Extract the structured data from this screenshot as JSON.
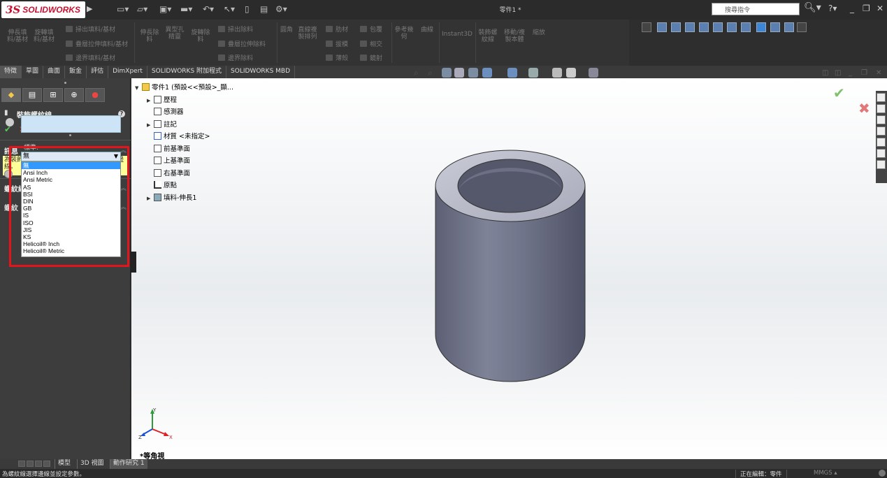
{
  "app": {
    "logo_ds": "3S",
    "logo_text": "SOLIDWORKS",
    "document_title": "零件1 *",
    "search_placeholder": "搜尋指令"
  },
  "commands": {
    "extrude_boss": "伸長填\n料/基材",
    "revolve_boss": "旋轉填\n料/基材",
    "swept_boss": "掃出填料/基材",
    "loft_boss": "疊層拉伸填料/基材",
    "boundary_boss": "邊界填料/基材",
    "extrude_cut": "伸長除\n料",
    "hole_wizard": "異型孔\n精靈",
    "revolve_cut": "旋轉除\n料",
    "swept_cut": "掃出除料",
    "loft_cut": "疊層拉伸除料",
    "boundary_cut": "邊界除料",
    "fillet": "圓角",
    "linear_pattern": "直線複\n製排列",
    "rib": "肋材",
    "wrap": "包覆",
    "draft": "拔模",
    "intersect": "相交",
    "shell": "薄殼",
    "mirror": "鏡射",
    "ref_geometry": "參考幾\n何",
    "curves": "曲線",
    "instant3d": "Instant3D",
    "cosmetic_thread": "裝飾螺\n紋線",
    "move_copy": "移動/複\n製本體",
    "scale": "縮放"
  },
  "tabs": [
    "特徵",
    "草圖",
    "曲面",
    "鈑金",
    "評估",
    "DimXpert",
    "SOLIDWORKS 附加程式",
    "SOLIDWORKS MBD"
  ],
  "property_manager": {
    "title": "裝飾螺紋線",
    "message_header": "訊息",
    "message_text": "為裝飾螺紋線的插入選擇一個圓形的模型邊線。",
    "thread_settings_header": "螺紋線設定(S)",
    "standard_label": "標準:",
    "standard_value": "無",
    "standard_options": [
      "無",
      "Ansi Inch",
      "Ansi Metric",
      "AS",
      "BSI",
      "DIN",
      "GB",
      "IS",
      "ISO",
      "JIS",
      "KS",
      "Helicoil® Inch",
      "Helicoil® Metric"
    ],
    "lower_section_header": "螺紋"
  },
  "feature_tree": {
    "root": "零件1 (預設<<預設>_顯...",
    "items": [
      "歷程",
      "感測器",
      "註記",
      "材質 <未指定>",
      "前基準面",
      "上基準面",
      "右基準面",
      "原點",
      "填料-伸長1"
    ]
  },
  "viewport": {
    "view_name": "*等角視",
    "triad_x": "X",
    "triad_y": "Y",
    "triad_z": "Z",
    "model_color": "#7c7f93"
  },
  "bottom_tabs": [
    "模型",
    "3D 視圖",
    "動作研究 1"
  ],
  "status": {
    "message": "為螺紋線選擇邊線並設定參數。",
    "editing": "正在編輯：零件",
    "units": "MMGS"
  }
}
